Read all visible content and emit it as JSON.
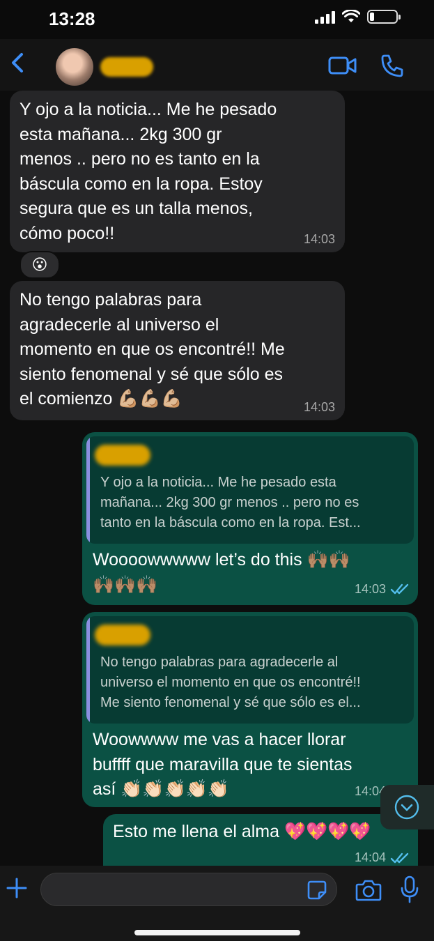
{
  "status_bar": {
    "time": "13:28"
  },
  "messages": {
    "m1": {
      "text": "Y ojo a la noticia... Me he pesado\nesta mañana... 2kg 300 gr\nmenos .. pero no es tanto en la\nbáscula como en la ropa. Estoy\nsegura que es un talla menos,\ncómo poco!!",
      "time": "14:03"
    },
    "m1_reaction": "😮",
    "m2": {
      "text": "No tengo palabras para\nagradecerle al universo el\nmomento en que os encontré!! Me\nsiento fenomenal y sé que sólo es\nel comienzo 💪🏼💪🏼💪🏼",
      "time": "14:03"
    },
    "m3": {
      "quote": "Y ojo a la noticia... Me he pesado esta\nmañana... 2kg 300 gr menos .. pero no es\ntanto en la báscula como en la ropa. Est...",
      "text": "Woooowwwww let’s do this 🙌🏽🙌🏽\n🙌🏽🙌🏽🙌🏽",
      "time": "14:03"
    },
    "m4": {
      "quote": "No tengo palabras para agradecerle al\nuniverso el momento en que os encontré!!\nMe siento fenomenal y sé que sólo es el...",
      "text": "Woowwww me vas a hacer llorar\nbuffff que maravilla que te sientas\nasí 👏🏻👏🏻👏🏻👏🏻👏🏻",
      "time": "14:04"
    },
    "m5": {
      "text": "Esto me llena el alma 💖💖💖💖",
      "time": "14:04"
    }
  },
  "colors": {
    "incoming_bubble": "#262628",
    "outgoing_bubble": "#0b5144",
    "accent": "#3e8ef7",
    "read_ticks": "#53bdeb"
  },
  "icons": [
    "back-icon",
    "video-call-icon",
    "phone-icon",
    "double-check-icon",
    "chevron-down-icon",
    "plus-icon",
    "sticker-icon",
    "camera-icon",
    "mic-icon"
  ]
}
